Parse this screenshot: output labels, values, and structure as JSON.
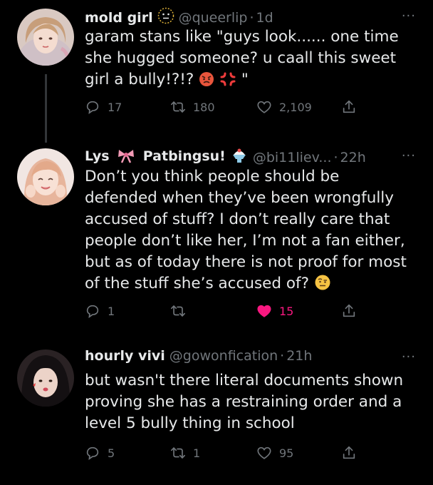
{
  "tweets": [
    {
      "name": "mold girl",
      "handle": "@queerlip",
      "time": "1d",
      "more": "···",
      "text": "garam stans like \"guys look...... one time she hugged someone? u caall this sweet girl a bully!?!?",
      "text_tail": " \"",
      "replies": "17",
      "retweets": "180",
      "likes": "2,109",
      "liked": false
    },
    {
      "name": "Lys",
      "name2": "Patbingsu!",
      "handle": "@bi11liev...",
      "time": "22h",
      "more": "···",
      "text": "Don’t you think people should be defended when they’ve been wrongfully accused of stuff? I don’t really care that people don’t like her, I’m not a fan either, but as of today there is not proof for most of the stuff she’s accused of?",
      "replies": "1",
      "retweets": "",
      "likes": "15",
      "liked": true
    },
    {
      "name": "hourly vivi",
      "handle": "@gowonfication",
      "time": "21h",
      "more": "···",
      "text": "but wasn't there literal documents shown proving she has a restraining order and a level 5 bully thing in school",
      "replies": "5",
      "retweets": "1",
      "likes": "95",
      "liked": false
    }
  ],
  "colors": {
    "background": "#000000",
    "text": "#e7e9ea",
    "muted": "#71767b",
    "like": "#f91880",
    "line": "#333639"
  },
  "icons": [
    "reply-icon",
    "retweet-icon",
    "like-icon",
    "share-icon",
    "more-icon"
  ]
}
